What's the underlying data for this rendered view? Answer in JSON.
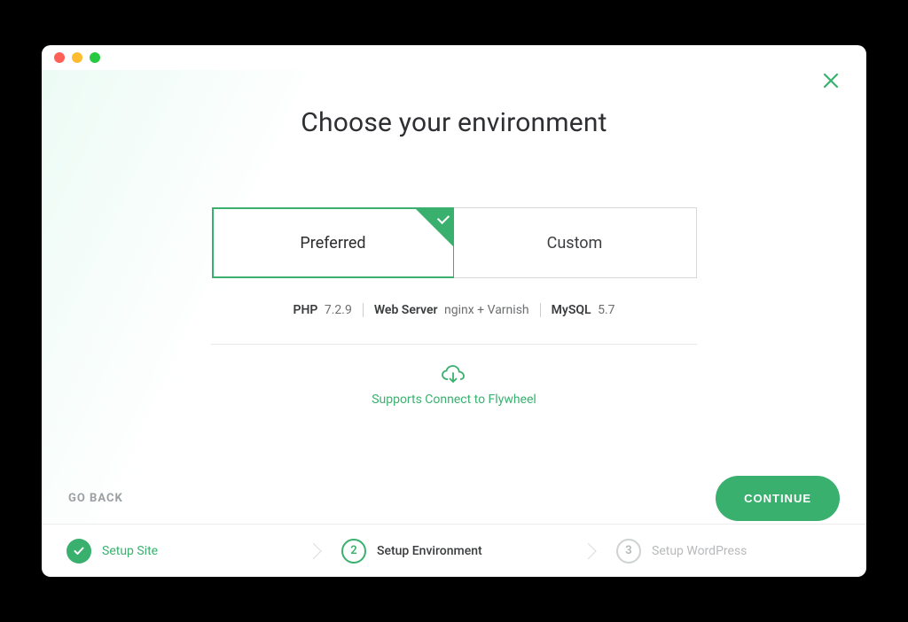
{
  "title": "Choose your environment",
  "options": {
    "preferred": "Preferred",
    "custom": "Custom"
  },
  "specs": {
    "php_label": "PHP",
    "php_value": "7.2.9",
    "webserver_label": "Web Server",
    "webserver_value": "nginx + Varnish",
    "mysql_label": "MySQL",
    "mysql_value": "5.7"
  },
  "flywheel_text": "Supports Connect to Flywheel",
  "actions": {
    "go_back": "GO BACK",
    "continue": "CONTINUE"
  },
  "steps": {
    "s1": {
      "num": "",
      "label": "Setup Site"
    },
    "s2": {
      "num": "2",
      "label": "Setup Environment"
    },
    "s3": {
      "num": "3",
      "label": "Setup WordPress"
    }
  },
  "accent": "#3ab06f"
}
